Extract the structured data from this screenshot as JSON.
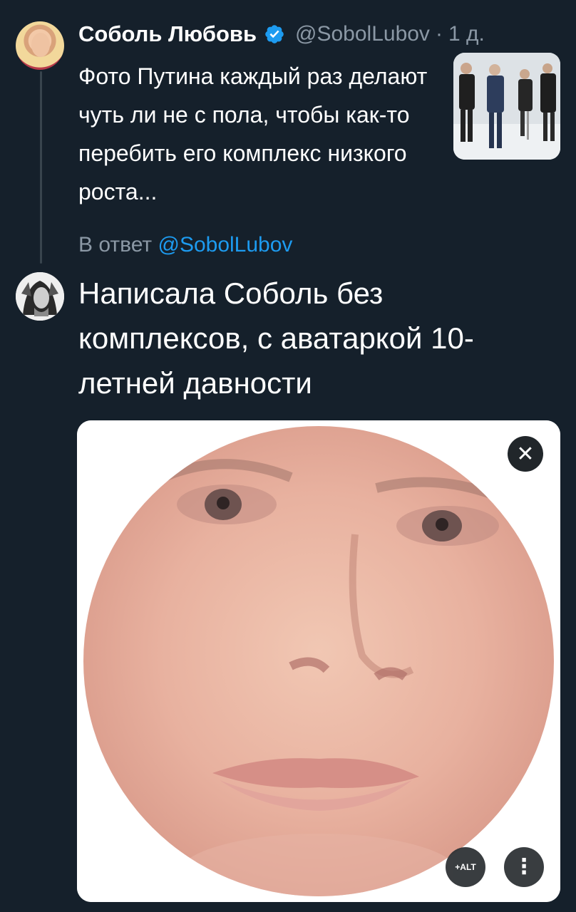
{
  "tweet1": {
    "author_name": "Соболь Любовь",
    "handle": "@SobolLubov",
    "separator": "·",
    "time": "1 д.",
    "text": "Фото Путина каждый раз делают чуть ли не с пола, чтобы как-то перебить его комплекс низкого роста..."
  },
  "reply": {
    "prefix": "В ответ",
    "handle": "@SobolLubov",
    "text": "Написала Соболь без комплексов, с аватаркой 10-летней давности"
  },
  "media_controls": {
    "close_label": "✕",
    "alt_label": "+ALT",
    "more_label": "⋮"
  },
  "colors": {
    "background": "#15202b",
    "link": "#1d9bf0",
    "muted": "#8b98a5",
    "verified": "#1d9bf0"
  },
  "icons": [
    "verified-badge-icon",
    "close-icon",
    "alt-text-icon",
    "more-options-icon"
  ]
}
